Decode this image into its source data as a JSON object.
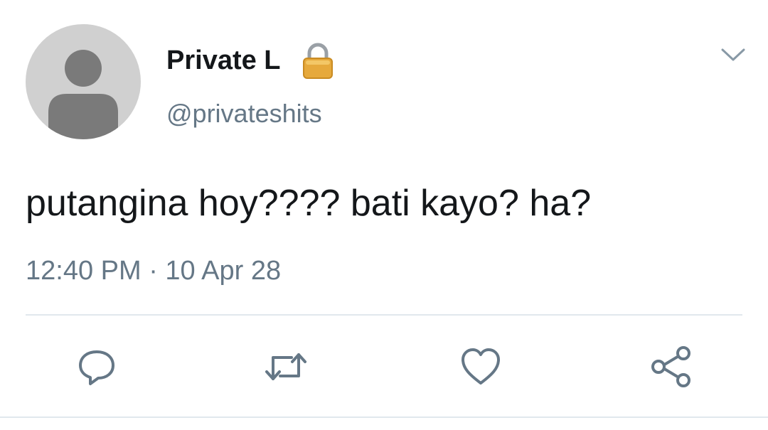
{
  "tweet": {
    "display_name": "Private L",
    "handle": "@privateshits",
    "text": "putangina hoy???? bati kayo? ha?",
    "timestamp": "12:40 PM · 10 Apr 28"
  },
  "icons": {
    "avatar": "default-avatar-icon",
    "lock": "lock-icon",
    "menu": "chevron-down-icon",
    "reply": "reply-icon",
    "retweet": "retweet-icon",
    "like": "heart-icon",
    "share": "share-icon"
  },
  "colors": {
    "text_primary": "#14171a",
    "text_secondary": "#657786",
    "icon_gray": "#657786",
    "divider": "#e1e8ed",
    "avatar_bg": "#d0d0d0",
    "avatar_silhouette": "#7a7a7a",
    "lock_gold": "#e6a93c"
  }
}
